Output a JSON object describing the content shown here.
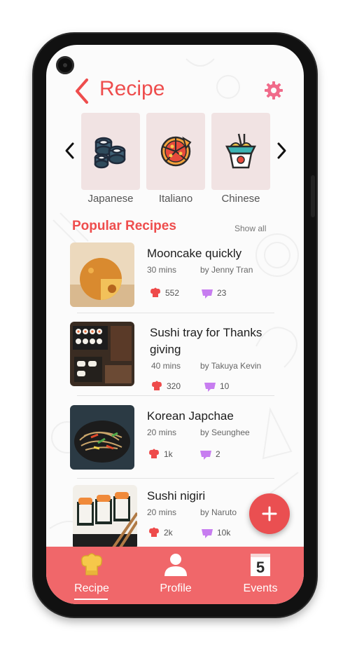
{
  "header": {
    "title": "Recipe"
  },
  "categories": [
    {
      "label": "Japanese",
      "icon": "sushi-icon"
    },
    {
      "label": "Italiano",
      "icon": "pizza-icon"
    },
    {
      "label": "Chinese",
      "icon": "noodle-box-icon"
    }
  ],
  "popular": {
    "title": "Popular Recipes",
    "show_all": "Show all",
    "recipes": [
      {
        "name": "Mooncake quickly",
        "time": "30 mins",
        "author": "by Jenny Tran",
        "likes": "552",
        "comments": "23"
      },
      {
        "name": "Sushi tray for Thanks giving",
        "time": "40 mins",
        "author": "by Takuya Kevin",
        "likes": "320",
        "comments": "10"
      },
      {
        "name": "Korean Japchae",
        "time": "20 mins",
        "author": "by  Seunghee",
        "likes": "1k",
        "comments": "2"
      },
      {
        "name": "Sushi nigiri",
        "time": "20 mins",
        "author": "by  Naruto",
        "likes": "2k",
        "comments": "10k"
      }
    ]
  },
  "nav": {
    "items": [
      {
        "label": "Recipe",
        "icon": "chef-hat-icon",
        "active": true
      },
      {
        "label": "Profile",
        "icon": "person-icon",
        "active": false
      },
      {
        "label": "Events",
        "icon": "calendar-icon",
        "active": false
      }
    ],
    "events_day": "5"
  },
  "colors": {
    "accent": "#ee4d4d",
    "navbar": "#f0676a",
    "tile": "#f1e3e3",
    "heart": "#ee4b4b",
    "comment": "#c77df0"
  }
}
